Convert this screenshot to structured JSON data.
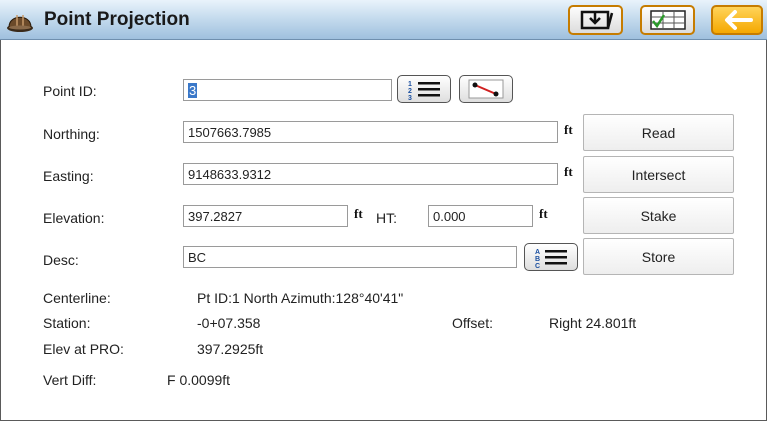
{
  "window": {
    "title": "Point Projection"
  },
  "toolbar": {
    "save_icon": "save-download-icon",
    "table_icon": "table-check-icon",
    "back_icon": "back-arrow-icon"
  },
  "form": {
    "point_id": {
      "label": "Point ID:",
      "value": "3"
    },
    "northing": {
      "label": "Northing:",
      "value": "1507663.7985",
      "unit": "ft"
    },
    "easting": {
      "label": "Easting:",
      "value": "9148633.9312",
      "unit": "ft"
    },
    "elevation": {
      "label": "Elevation:",
      "value": "397.2827",
      "unit": "ft"
    },
    "ht": {
      "label": "HT:",
      "value": "0.000",
      "unit": "ft"
    },
    "desc": {
      "label": "Desc:",
      "value": "BC"
    }
  },
  "buttons": {
    "read": "Read",
    "intersect": "Intersect",
    "stake": "Stake",
    "store": "Store"
  },
  "results": {
    "centerline_label": "Centerline:",
    "centerline_value": "Pt ID:1 North Azimuth:128°40'41\"",
    "station_label": "Station:",
    "station_value": "-0+07.358",
    "offset_label": "Offset:",
    "offset_value": "Right 24.801ft",
    "elev_pro_label": "Elev at PRO:",
    "elev_pro_value": "397.2925ft",
    "vert_diff_label": "Vert Diff:",
    "vert_diff_value": "F 0.0099ft"
  },
  "colors": {
    "titlebar": "#c6dcee",
    "accent_orange": "#f5a800",
    "selection": "#3a78c9"
  }
}
